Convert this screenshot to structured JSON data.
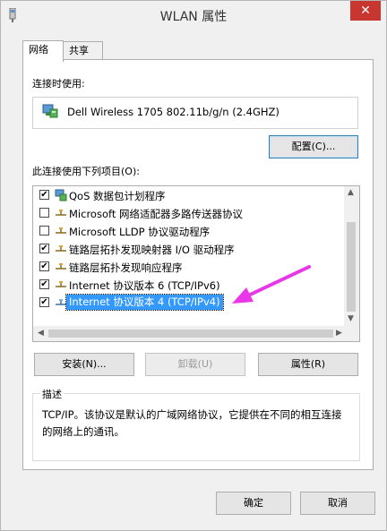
{
  "window": {
    "title": "WLAN 属性",
    "close_glyph": "✕"
  },
  "tabs": [
    {
      "label": "网络"
    },
    {
      "label": "共享"
    }
  ],
  "connect_using": {
    "label": "连接时使用:",
    "adapter": "Dell Wireless 1705 802.11b/g/n (2.4GHZ)",
    "adapter_icon": "network-adapter-icon",
    "configure_button": "配置(C)..."
  },
  "items_section": {
    "label": "此连接使用下列项目(O):",
    "items": [
      {
        "checked": true,
        "icon": "qos-scheduler-icon",
        "label": "QoS 数据包计划程序"
      },
      {
        "checked": false,
        "icon": "protocol-icon",
        "label": "Microsoft 网络适配器多路传送器协议"
      },
      {
        "checked": false,
        "icon": "protocol-icon",
        "label": "Microsoft LLDP 协议驱动程序"
      },
      {
        "checked": true,
        "icon": "protocol-icon",
        "label": "链路层拓扑发现映射器 I/O 驱动程序"
      },
      {
        "checked": true,
        "icon": "protocol-icon",
        "label": "链路层拓扑发现响应程序"
      },
      {
        "checked": true,
        "icon": "protocol-icon",
        "label": "Internet 协议版本 6 (TCP/IPv6)"
      },
      {
        "checked": true,
        "icon": "protocol-icon",
        "label": "Internet 协议版本 4 (TCP/IPv4)",
        "selected": true
      }
    ],
    "checkmark_glyph": "✔",
    "install_button": "安装(N)...",
    "uninstall_button": "卸载(U)",
    "properties_button": "属性(R)"
  },
  "description": {
    "title": "描述",
    "text": "TCP/IP。该协议是默认的广域网络协议，它提供在不同的相互连接的网络上的通讯。"
  },
  "footer": {
    "ok_button": "确定",
    "cancel_button": "取消"
  },
  "colors": {
    "selection": "#3399ff",
    "annotation_arrow": "#e936e6",
    "close": "#c7372f"
  }
}
